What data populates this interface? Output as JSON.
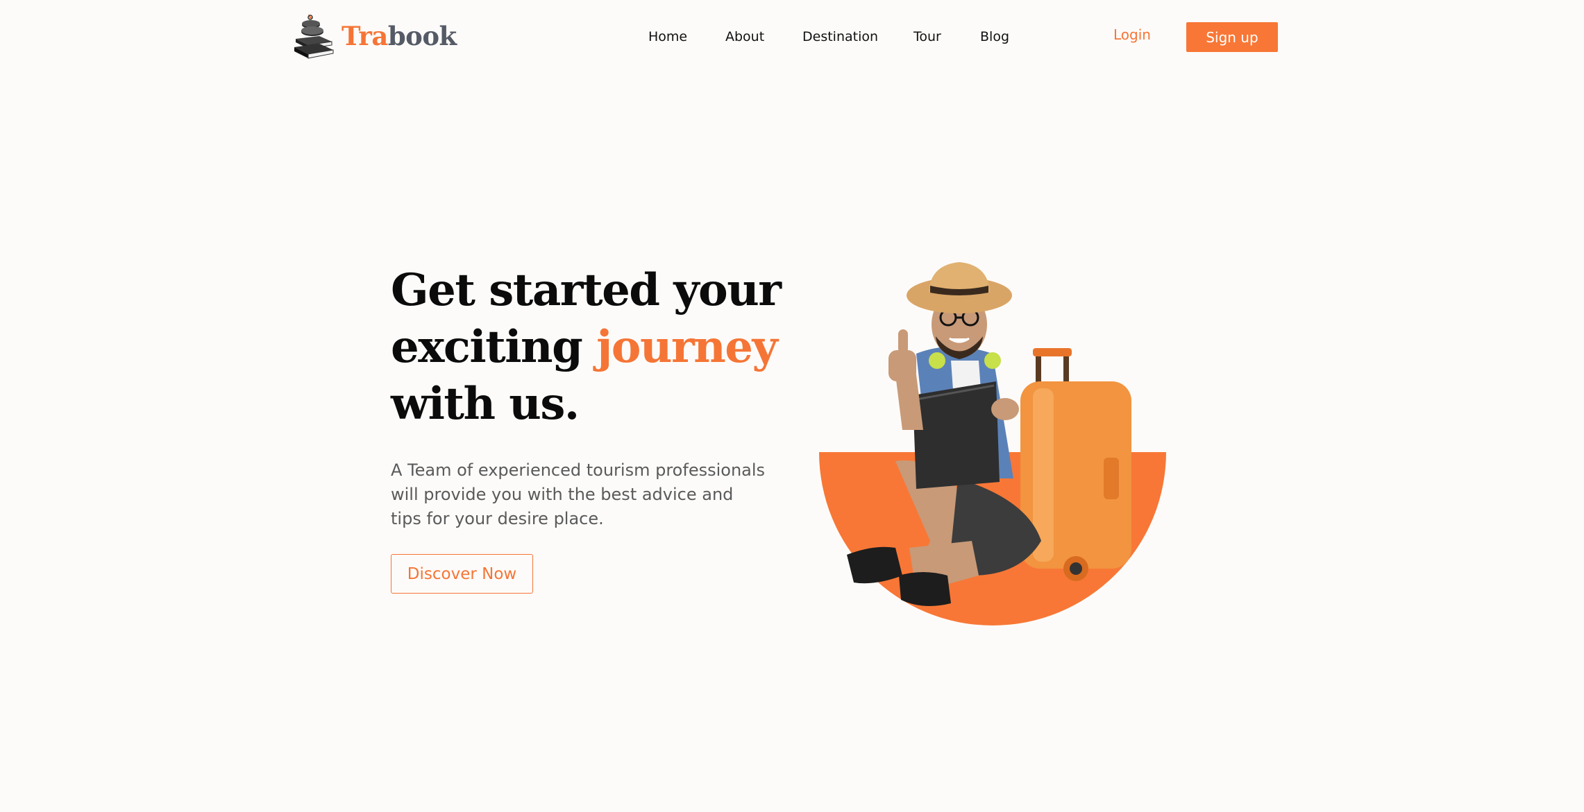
{
  "brand": {
    "name_accent": "Tra",
    "name_rest": "book",
    "accent_color": "#f57536",
    "rest_color": "#555b66",
    "icon": "stacked-books-compass-icon"
  },
  "nav": {
    "items": [
      {
        "label": "Home"
      },
      {
        "label": "About"
      },
      {
        "label": "Destination"
      },
      {
        "label": "Tour"
      },
      {
        "label": "Blog"
      }
    ],
    "login_label": "Login",
    "signup_label": "Sign up"
  },
  "hero": {
    "title_line1": "Get started your",
    "title_line2_start": "exciting ",
    "title_highlight": "journey",
    "title_line3": "with us.",
    "description": "A Team of experienced tourism professionals will provide you with the best advice and tips for your desire place.",
    "cta_label": "Discover Now",
    "image": "traveler-with-suitcase-illustration"
  },
  "colors": {
    "accent": "#f57536",
    "background": "#fdfbf9",
    "heading": "#0b0b0b",
    "body_text": "#5a5a5a"
  }
}
